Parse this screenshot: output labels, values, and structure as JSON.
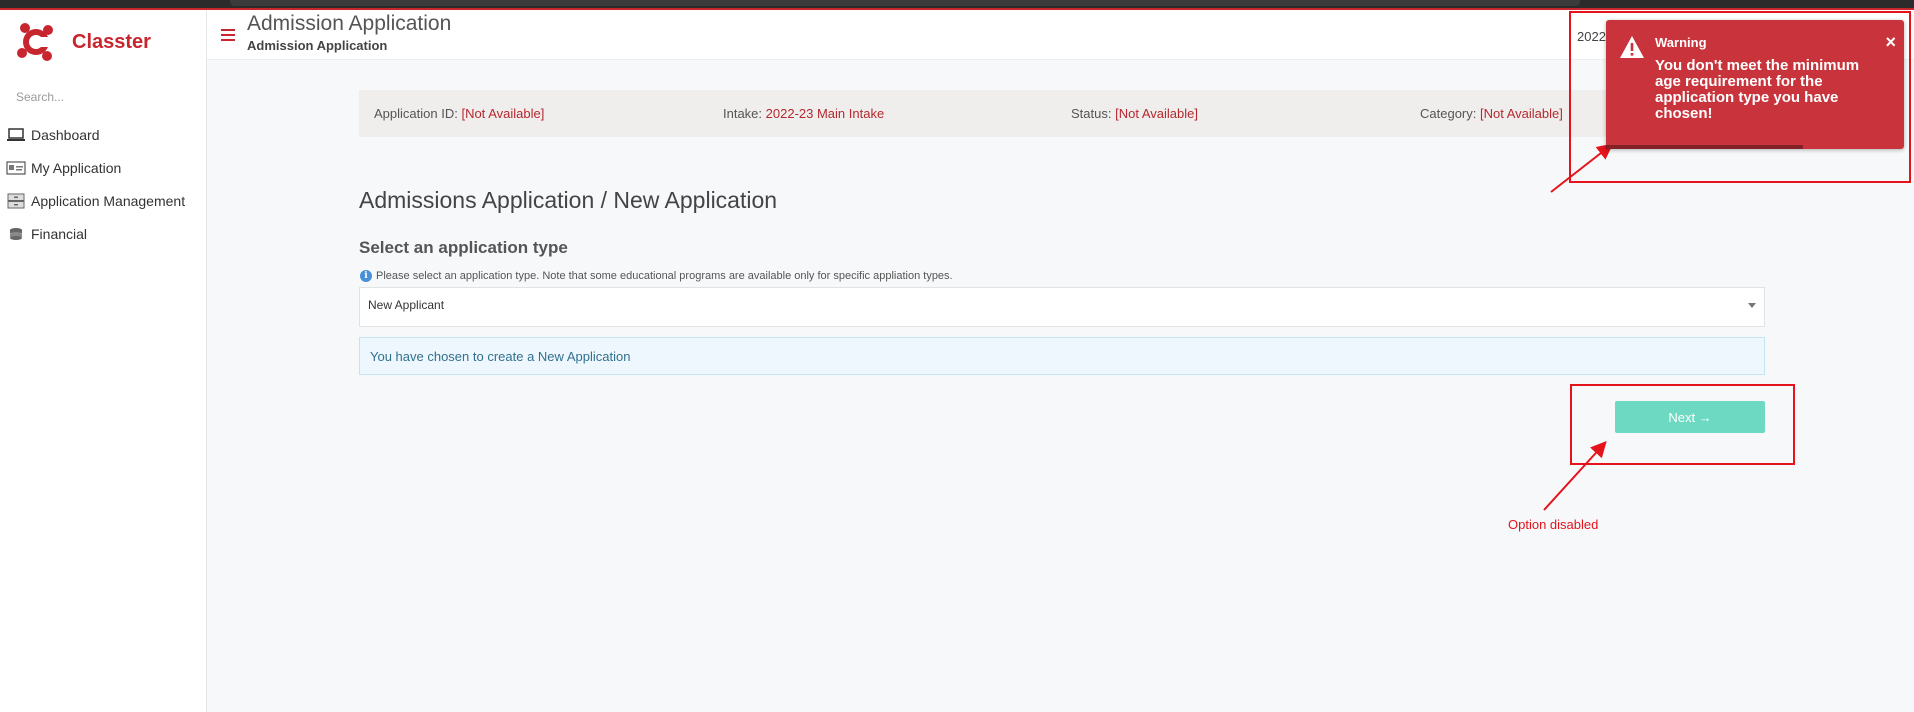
{
  "app": {
    "name": "Classter",
    "brand_color": "#c8262f"
  },
  "sidebar": {
    "search_placeholder": "Search...",
    "items": [
      {
        "label": "Dashboard",
        "icon": "laptop-icon"
      },
      {
        "label": "My Application",
        "icon": "id-card-icon"
      },
      {
        "label": "Application Management",
        "icon": "cabinet-icon"
      },
      {
        "label": "Financial",
        "icon": "coins-icon"
      }
    ]
  },
  "header": {
    "title": "Admission Application",
    "subtitle": "Admission Application",
    "year_prefix": "2022"
  },
  "info_bar": {
    "application_id_label": "Application ID:",
    "application_id_value": "[Not Available]",
    "intake_label": "Intake:",
    "intake_value": "2022-23 Main Intake",
    "status_label": "Status:",
    "status_value": "[Not Available]",
    "category_label": "Category:",
    "category_value": "[Not Available]"
  },
  "main": {
    "title": "Admissions Application / New Application",
    "section_title": "Select an application type",
    "hint": "Please select an application type. Note that some educational programs are available only for specific appliation types.",
    "application_type_selected": "New Applicant",
    "notice": "You have chosen to create a New Application",
    "next_button": "Next →",
    "next_enabled": false
  },
  "toast": {
    "title": "Warning",
    "message": "You don't meet the minimum age requirement for the application type you have chosen!",
    "close": "×",
    "progress": 0.66,
    "color": "#c9343c"
  },
  "annotation": {
    "label": "Option disabled",
    "color": "#e5131b"
  }
}
